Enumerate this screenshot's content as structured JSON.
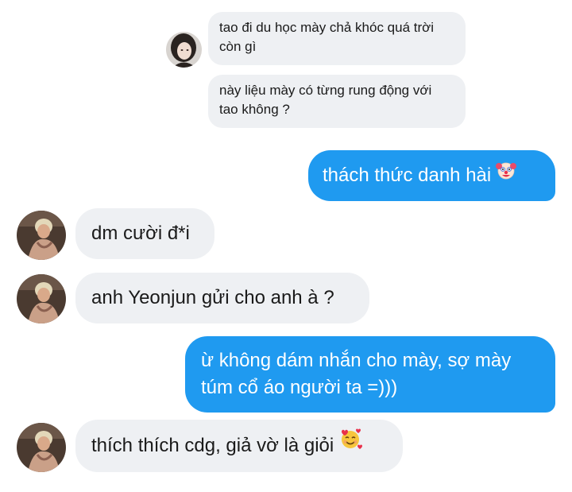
{
  "messages": {
    "quoted_1": "tao đi du học mày chả khóc quá trời\ncòn gì",
    "quoted_2": "này liệu mày có từng rung động với\ntao không ?",
    "sent_1": "thách thức danh hài",
    "sent_1_emoji": "clown-face",
    "received_1": "dm cười đ*i",
    "received_2": "anh Yeonjun gửi cho anh à ?",
    "sent_2": "ừ không dám nhắn cho mày, sợ mày\ntúm cổ áo người ta =)))",
    "received_3": "thích thích cdg, giả vờ là giỏi",
    "received_3_emoji": "smiling-face-with-hearts"
  },
  "colors": {
    "outgoing_bubble": "#1f9af0",
    "incoming_bubble": "#eef0f3",
    "background": "#ffffff"
  }
}
